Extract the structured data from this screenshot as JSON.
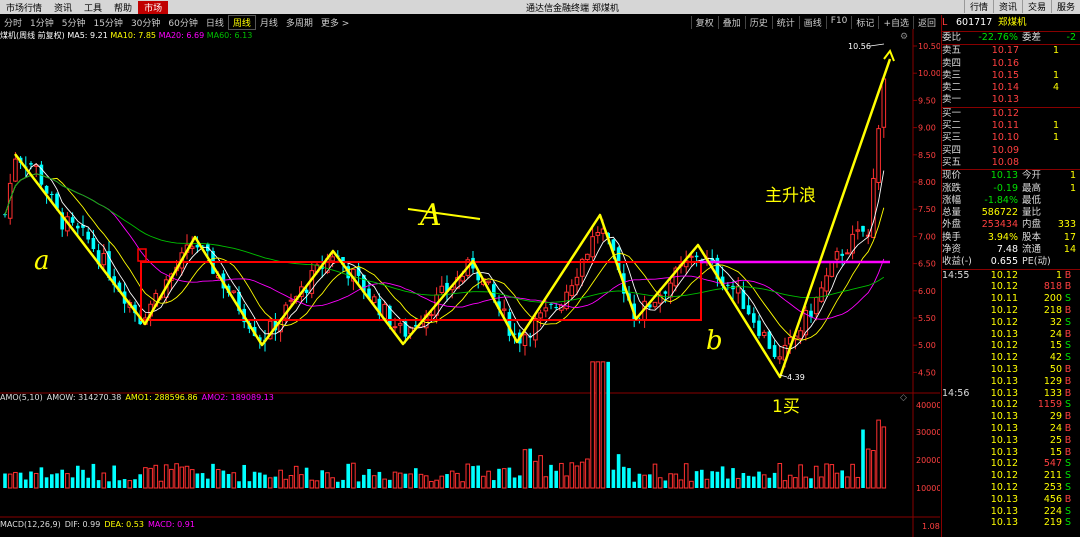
{
  "menu": {
    "items": [
      "市场行情",
      "资讯",
      "工具",
      "帮助"
    ],
    "active": "市场",
    "title": "通达信金融终端  郑煤机",
    "right": [
      "行情",
      "资讯",
      "交易",
      "服务"
    ]
  },
  "toolbar": {
    "periods": [
      "分时",
      "1分钟",
      "5分钟",
      "15分钟",
      "30分钟",
      "60分钟",
      "日线",
      "周线",
      "月线",
      "多周期",
      "更多 >"
    ],
    "selected": "周线",
    "right": [
      "复权",
      "叠加",
      "历史",
      "统计",
      "画线",
      "F10",
      "标记",
      "+自选",
      "返回"
    ]
  },
  "indicators": {
    "stock": "煤机(周线 前复权)",
    "ma5": "MA5: 9.21",
    "ma10": "MA10: 7.85",
    "ma20": "MA20: 6.69",
    "ma60": "MA60: 6.13",
    "amo": "AMO(5,10)",
    "amow": "AMOW: 314270.38",
    "amo1": "AMO1: 288596.86",
    "amo2": "AMO2: 189089.13",
    "macd_title": "MACD(12,26,9)",
    "dif": "DIF: 0.99",
    "dea": "DEA: 0.53",
    "macd": "MACD: 0.91"
  },
  "annotations": {
    "a": "a",
    "b": "b",
    "A": "A",
    "main_rise": "主升浪",
    "buy1": "1买",
    "high_label": "10.56",
    "low_label": "4.39"
  },
  "price_axis": [
    "10.50",
    "10.00",
    "9.50",
    "9.00",
    "8.50",
    "8.00",
    "7.50",
    "7.00",
    "6.50",
    "6.00",
    "5.50",
    "5.00",
    "4.50"
  ],
  "vol_axis": [
    "40000",
    "30000",
    "20000",
    "10000"
  ],
  "macd_axis": [
    "1.08"
  ],
  "side": {
    "header_prefix": "L",
    "header_code": "601717",
    "header_name": "郑煤机",
    "weibi_label": "委比",
    "weibi_value": "-22.76%",
    "weicha_label": "委差",
    "weicha_value": "-2",
    "asks": [
      {
        "label": "卖五",
        "price": "10.17",
        "vol": "1"
      },
      {
        "label": "卖四",
        "price": "10.16",
        "vol": ""
      },
      {
        "label": "卖三",
        "price": "10.15",
        "vol": "1"
      },
      {
        "label": "卖二",
        "price": "10.14",
        "vol": "4"
      },
      {
        "label": "卖一",
        "price": "10.13",
        "vol": ""
      }
    ],
    "bids": [
      {
        "label": "买一",
        "price": "10.12",
        "vol": ""
      },
      {
        "label": "买二",
        "price": "10.11",
        "vol": "1"
      },
      {
        "label": "买三",
        "price": "10.10",
        "vol": "1"
      },
      {
        "label": "买四",
        "price": "10.09",
        "vol": ""
      },
      {
        "label": "买五",
        "price": "10.08",
        "vol": ""
      }
    ],
    "stats": [
      {
        "k": "现价",
        "v": "10.13",
        "vc": "green",
        "k2": "今开",
        "v2": "1"
      },
      {
        "k": "涨跌",
        "v": "-0.19",
        "vc": "green",
        "k2": "最高",
        "v2": "1"
      },
      {
        "k": "涨幅",
        "v": "-1.84%",
        "vc": "green",
        "k2": "最低",
        "v2": ""
      },
      {
        "k": "总量",
        "v": "586722",
        "vc": "yellow",
        "k2": "量比",
        "v2": ""
      },
      {
        "k": "外盘",
        "v": "253434",
        "vc": "red",
        "k2": "内盘",
        "v2": "333"
      },
      {
        "k": "换手",
        "v": "3.94%",
        "vc": "yellow",
        "k2": "股本",
        "v2": "17"
      },
      {
        "k": "净资",
        "v": "7.48",
        "vc": "white",
        "k2": "流通",
        "v2": "14"
      },
      {
        "k": "收益(-)",
        "v": "0.655",
        "vc": "white",
        "k2": "PE(动)",
        "v2": ""
      }
    ],
    "ticks": [
      {
        "t": "14:55",
        "p": "10.12",
        "q": "1",
        "qc": "yellow",
        "d": "B",
        "dc": "red"
      },
      {
        "t": "",
        "p": "10.12",
        "q": "818",
        "qc": "red",
        "d": "B",
        "dc": "red"
      },
      {
        "t": "",
        "p": "10.11",
        "q": "200",
        "qc": "yellow",
        "d": "S",
        "dc": "green"
      },
      {
        "t": "",
        "p": "10.12",
        "q": "218",
        "qc": "yellow",
        "d": "B",
        "dc": "red"
      },
      {
        "t": "",
        "p": "10.12",
        "q": "32",
        "qc": "yellow",
        "d": "S",
        "dc": "green"
      },
      {
        "t": "",
        "p": "10.13",
        "q": "24",
        "qc": "yellow",
        "d": "B",
        "dc": "red"
      },
      {
        "t": "",
        "p": "10.12",
        "q": "15",
        "qc": "yellow",
        "d": "S",
        "dc": "green"
      },
      {
        "t": "",
        "p": "10.12",
        "q": "42",
        "qc": "yellow",
        "d": "S",
        "dc": "green"
      },
      {
        "t": "",
        "p": "10.13",
        "q": "50",
        "qc": "yellow",
        "d": "B",
        "dc": "red"
      },
      {
        "t": "",
        "p": "10.13",
        "q": "129",
        "qc": "yellow",
        "d": "B",
        "dc": "red"
      },
      {
        "t": "14:56",
        "p": "10.13",
        "q": "133",
        "qc": "yellow",
        "d": "B",
        "dc": "red"
      },
      {
        "t": "",
        "p": "10.12",
        "q": "1159",
        "qc": "red",
        "d": "S",
        "dc": "green"
      },
      {
        "t": "",
        "p": "10.13",
        "q": "29",
        "qc": "yellow",
        "d": "B",
        "dc": "red"
      },
      {
        "t": "",
        "p": "10.13",
        "q": "24",
        "qc": "yellow",
        "d": "B",
        "dc": "red"
      },
      {
        "t": "",
        "p": "10.13",
        "q": "25",
        "qc": "yellow",
        "d": "B",
        "dc": "red"
      },
      {
        "t": "",
        "p": "10.13",
        "q": "15",
        "qc": "yellow",
        "d": "B",
        "dc": "red"
      },
      {
        "t": "",
        "p": "10.12",
        "q": "547",
        "qc": "red",
        "d": "S",
        "dc": "green"
      },
      {
        "t": "",
        "p": "10.12",
        "q": "211",
        "qc": "yellow",
        "d": "S",
        "dc": "green"
      },
      {
        "t": "",
        "p": "10.12",
        "q": "253",
        "qc": "yellow",
        "d": "S",
        "dc": "green"
      },
      {
        "t": "",
        "p": "10.13",
        "q": "456",
        "qc": "yellow",
        "d": "B",
        "dc": "red"
      },
      {
        "t": "",
        "p": "10.13",
        "q": "224",
        "qc": "yellow",
        "d": "S",
        "dc": "green"
      },
      {
        "t": "",
        "p": "10.13",
        "q": "219",
        "qc": "yellow",
        "d": "S",
        "dc": "green"
      }
    ]
  },
  "colors": {
    "up": "#ff3030",
    "down": "#00ffff",
    "ma5": "#ffffff",
    "ma10": "#ffff00",
    "ma20": "#ff00ff",
    "ma60": "#00c000",
    "box": "#ff0000",
    "pen": "#ffff00",
    "neck": "#ff00ff"
  },
  "icons": {
    "settings": "gear-icon",
    "close": "close-icon"
  }
}
